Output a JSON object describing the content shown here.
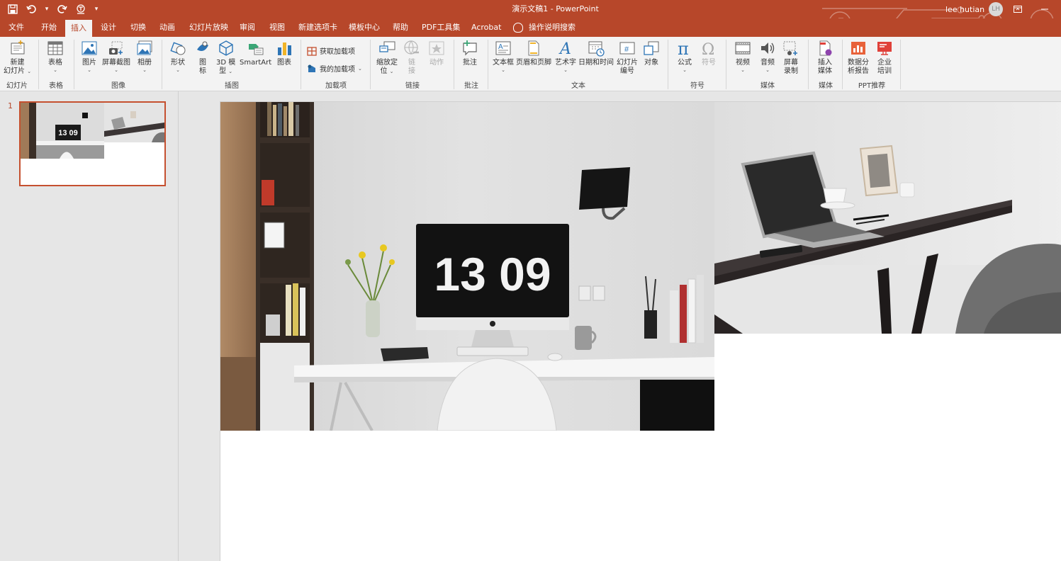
{
  "window": {
    "doc_title": "演示文稿1  -  PowerPoint",
    "user_name": "lee hutian",
    "user_initials": "LH"
  },
  "quick_access": [
    {
      "name": "save-icon"
    },
    {
      "name": "undo-icon"
    },
    {
      "name": "redo-icon"
    },
    {
      "name": "touch-mode-icon"
    },
    {
      "name": "customize-qat-icon"
    }
  ],
  "tabs": [
    "文件",
    "开始",
    "插入",
    "设计",
    "切换",
    "动画",
    "幻灯片放映",
    "审阅",
    "视图",
    "新建选项卡",
    "模板中心",
    "帮助",
    "PDF工具集",
    "Acrobat"
  ],
  "active_tab": "插入",
  "tell_me": "操作说明搜索",
  "ribbon": {
    "groups": {
      "slides": "幻灯片",
      "tables": "表格",
      "images": "图像",
      "illustrations": "插图",
      "addins": "加载项",
      "links": "链接",
      "comments": "批注",
      "text": "文本",
      "symbols": "符号",
      "media": "媒体",
      "media2": "媒体",
      "ppt_recommend": "PPT推荐"
    },
    "buttons": {
      "new_slide_1": "新建",
      "new_slide_2": "幻灯片",
      "table": "表格",
      "picture": "图片",
      "screenshot": "屏幕截图",
      "album": "相册",
      "shapes": "形状",
      "icons_1": "图",
      "icons_2": "标",
      "model3d_1": "3D 模",
      "model3d_2": "型",
      "smartart": "SmartArt",
      "chart": "图表",
      "get_addins": "获取加载项",
      "my_addins": "我的加载项",
      "zoom_1": "缩放定",
      "zoom_2": "位",
      "link_1": "链",
      "link_2": "接",
      "action": "动作",
      "comment": "批注",
      "textbox": "文本框",
      "header_footer": "页眉和页脚",
      "wordart": "艺术字",
      "datetime": "日期和时间",
      "slide_number_1": "幻灯片",
      "slide_number_2": "编号",
      "object": "对象",
      "equation": "公式",
      "symbol": "符号",
      "video": "视频",
      "audio": "音频",
      "screen_rec_1": "屏幕",
      "screen_rec_2": "录制",
      "insert_media_1": "插入",
      "insert_media_2": "媒体",
      "data_report_1": "数据分",
      "data_report_2": "析报告",
      "training_1": "企业",
      "training_2": "培训"
    }
  },
  "slides": [
    {
      "number": "1",
      "clock_text": "13 09"
    }
  ],
  "colors": {
    "accent": "#b7472a",
    "ribbon_bg": "#f3f3f3",
    "pane_bg": "#e6e6e6"
  }
}
